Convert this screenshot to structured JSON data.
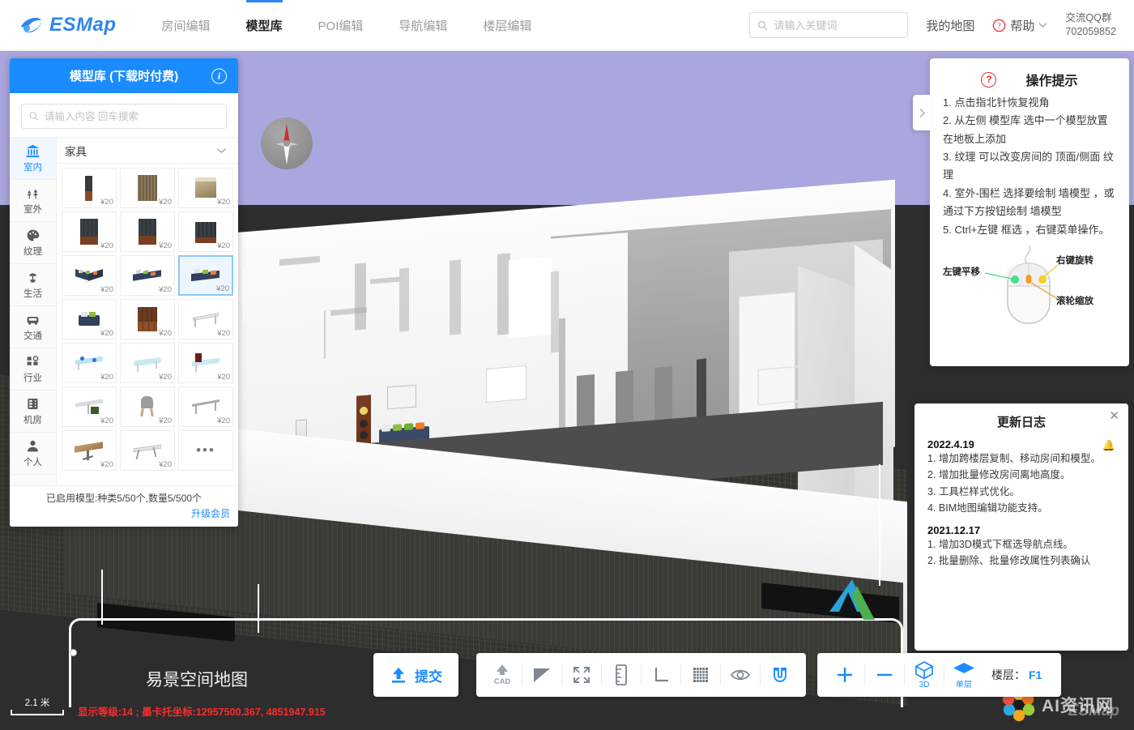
{
  "header": {
    "logo_text": "ESMap",
    "nav": [
      {
        "label": "房间编辑",
        "active": false
      },
      {
        "label": "模型库",
        "active": true
      },
      {
        "label": "POI编辑",
        "active": false
      },
      {
        "label": "导航编辑",
        "active": false
      },
      {
        "label": "楼层编辑",
        "active": false
      }
    ],
    "search_placeholder": "请输入关键词",
    "search_value": "",
    "my_map": "我的地图",
    "help": "帮助",
    "qq_line1": "交流QQ群",
    "qq_line2": "702059852"
  },
  "model_panel": {
    "title": "模型库 (下载时付费)",
    "info_icon": "info-icon",
    "search_placeholder": "请输入内容 回车搜索",
    "search_value": "",
    "categories": [
      {
        "label": "室内",
        "icon": "bank-icon",
        "active": true
      },
      {
        "label": "室外",
        "icon": "tree-icon",
        "active": false
      },
      {
        "label": "纹理",
        "icon": "palette-icon",
        "active": false
      },
      {
        "label": "生活",
        "icon": "plant-icon",
        "active": false
      },
      {
        "label": "交通",
        "icon": "car-icon",
        "active": false
      },
      {
        "label": "行业",
        "icon": "blocks-icon",
        "active": false
      },
      {
        "label": "机房",
        "icon": "server-icon",
        "active": false
      },
      {
        "label": "个人",
        "icon": "person-icon",
        "active": false
      }
    ],
    "group_title": "家具",
    "group_chevron": "chevron-down-icon",
    "price_label": "¥20",
    "models": [
      {
        "name": "bookshelf-tall",
        "price": "¥20",
        "selected": false
      },
      {
        "name": "wardrobe-wood",
        "price": "¥20",
        "selected": false
      },
      {
        "name": "cabinet-open",
        "price": "¥20",
        "selected": false
      },
      {
        "name": "bookcase-dark",
        "price": "¥20",
        "selected": false
      },
      {
        "name": "bookcase-dark-2",
        "price": "¥20",
        "selected": false
      },
      {
        "name": "shelf-grid",
        "price": "¥20",
        "selected": false
      },
      {
        "name": "sofa-corner",
        "price": "¥20",
        "selected": false
      },
      {
        "name": "sofa-long",
        "price": "¥20",
        "selected": false
      },
      {
        "name": "sofa-blue",
        "price": "¥20",
        "selected": true
      },
      {
        "name": "loveseat",
        "price": "¥20",
        "selected": false
      },
      {
        "name": "cabinet-wood",
        "price": "¥20",
        "selected": false
      },
      {
        "name": "table-white",
        "price": "¥20",
        "selected": false
      },
      {
        "name": "desk-glass",
        "price": "¥20",
        "selected": false
      },
      {
        "name": "table-glass",
        "price": "¥20",
        "selected": false
      },
      {
        "name": "table-wine",
        "price": "¥20",
        "selected": false
      },
      {
        "name": "desk-corner",
        "price": "¥20",
        "selected": false
      },
      {
        "name": "chair-modern",
        "price": "¥20",
        "selected": false
      },
      {
        "name": "table-thin",
        "price": "¥20",
        "selected": false
      },
      {
        "name": "table-wood",
        "price": "¥20",
        "selected": false
      },
      {
        "name": "bench-folding",
        "price": "¥20",
        "selected": false
      },
      {
        "name": "more",
        "price": "",
        "selected": false
      }
    ],
    "quota_text": "已启用模型:种类5/50个,数量5/500个",
    "upgrade_label": "升级会员"
  },
  "tips": {
    "icon": "question-icon",
    "title": "操作提示",
    "collapse_icon": "chevron-right-icon",
    "lines": [
      "1. 点击指北针恢复视角",
      "2. 从左侧 模型库 选中一个模型放置在地板上添加",
      "3. 纹理 可以改变房间的 顶面/侧面 纹理",
      "4. 室外-围栏 选择要绘制 墙模型 ，或通过下方按钮绘制 墙模型",
      "5. Ctrl+左键 框选 ，右键菜单操作。"
    ],
    "mouse": {
      "left": "左键平移",
      "right": "右键旋转",
      "wheel": "滚轮缩放",
      "left_color": "#49dc8c",
      "right_color": "#f2d024",
      "wheel_color": "#f59a23"
    }
  },
  "log": {
    "title": "更新日志",
    "close_icon": "close-icon",
    "bell_icon": "bell-icon",
    "entries": [
      {
        "date": "2022.4.19",
        "items": [
          "1. 增加跨楼层复制、移动房间和模型。",
          "2. 增加批量修改房间离地高度。",
          "3. 工具栏样式优化。",
          "4. BIM地图编辑功能支持。"
        ]
      },
      {
        "date": "2021.12.17",
        "items": [
          "1. 增加3D模式下框选导航点线。",
          "2. 批量删除、批量修改属性列表确认"
        ]
      }
    ]
  },
  "toolbar": {
    "submit_label": "提交",
    "submit_icon": "upload-icon",
    "tools": [
      {
        "name": "cad-upload-icon",
        "label": "CAD"
      },
      {
        "name": "polygon-icon",
        "label": ""
      },
      {
        "name": "fullscreen-icon",
        "label": ""
      },
      {
        "name": "ruler-icon",
        "label": ""
      },
      {
        "name": "angle-icon",
        "label": ""
      },
      {
        "name": "grid-icon",
        "label": ""
      },
      {
        "name": "eye-icon",
        "label": ""
      },
      {
        "name": "magnet-icon",
        "label": ""
      }
    ],
    "zoom_in": "+",
    "zoom_out": "−",
    "view_3d_label": "3D",
    "view_3d_icon": "cube-icon",
    "layer_label": "单层",
    "layer_icon": "layer-icon",
    "floor_label": "楼层：",
    "floor_value": "F1"
  },
  "status": {
    "map_title": "易景空间地图",
    "scale_text": "2.1 米",
    "coord_text": "显示等级:14 ; 墨卡托坐标:12957500.367, 4851947.915",
    "ai_watermark": "AI资讯网",
    "esmap_watermark": "ESMap"
  },
  "colors": {
    "accent": "#1a8cff",
    "nav_active": "#2f86f0",
    "sky": "#aaa6de",
    "status_red": "#ff2a2a",
    "tips_red": "#e03131"
  }
}
